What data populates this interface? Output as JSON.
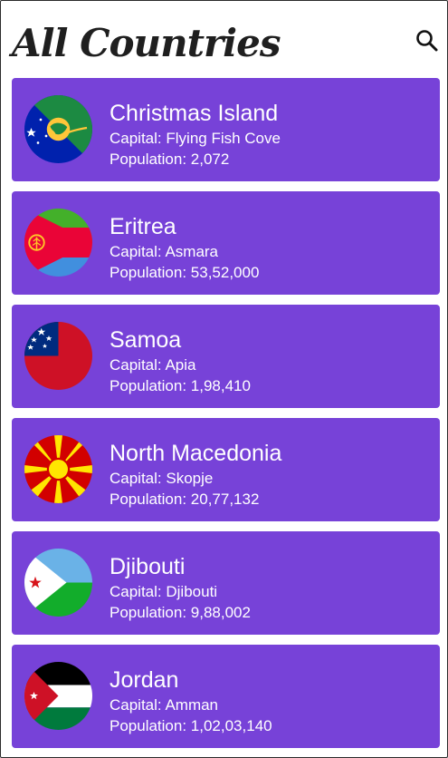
{
  "header": {
    "title": "All Countries",
    "search_icon": "search-icon"
  },
  "labels": {
    "capital_prefix": "Capital: ",
    "population_prefix": "Population: "
  },
  "colors": {
    "card_background": "#7742d8",
    "text": "#ffffff",
    "title": "#1f1f1f"
  },
  "countries": [
    {
      "name": "Christmas Island",
      "capital": "Flying Fish Cove",
      "population": "2,072",
      "flag_icon": "christmas-island-flag-icon"
    },
    {
      "name": "Eritrea",
      "capital": "Asmara",
      "population": "53,52,000",
      "flag_icon": "eritrea-flag-icon"
    },
    {
      "name": "Samoa",
      "capital": "Apia",
      "population": "1,98,410",
      "flag_icon": "samoa-flag-icon"
    },
    {
      "name": "North Macedonia",
      "capital": "Skopje",
      "population": "20,77,132",
      "flag_icon": "north-macedonia-flag-icon"
    },
    {
      "name": "Djibouti",
      "capital": "Djibouti",
      "population": "9,88,002",
      "flag_icon": "djibouti-flag-icon"
    },
    {
      "name": "Jordan",
      "capital": "Amman",
      "population": "1,02,03,140",
      "flag_icon": "jordan-flag-icon"
    }
  ]
}
